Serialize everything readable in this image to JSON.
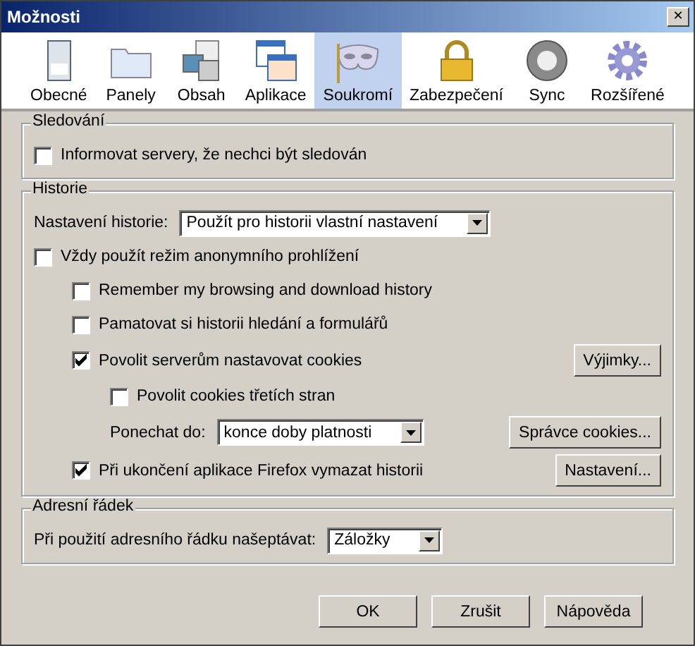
{
  "window": {
    "title": "Možnosti",
    "close": "✕"
  },
  "tabs": [
    {
      "label": "Obecné",
      "selected": false
    },
    {
      "label": "Panely",
      "selected": false
    },
    {
      "label": "Obsah",
      "selected": false
    },
    {
      "label": "Aplikace",
      "selected": false
    },
    {
      "label": "Soukromí",
      "selected": true
    },
    {
      "label": "Zabezpečení",
      "selected": false
    },
    {
      "label": "Sync",
      "selected": false
    },
    {
      "label": "Rozšířené",
      "selected": false
    }
  ],
  "tracking": {
    "title": "Sledování",
    "items": [
      {
        "kind": "checkbox",
        "label": "Informovat servery, že nechci být sledován",
        "checked": false
      }
    ]
  },
  "history": {
    "title": "Historie",
    "items": [
      {
        "kind": "select",
        "label": "Nastavení historie:",
        "value": "Použít pro historii vlastní nastavení"
      },
      {
        "kind": "checkbox",
        "label": "Vždy použít režim anonymního prohlížení",
        "checked": false,
        "children": [
          {
            "kind": "checkbox",
            "label": "Remember my browsing and download history",
            "checked": false
          },
          {
            "kind": "checkbox",
            "label": "Pamatovat si historii hledání a formulářů",
            "checked": false
          },
          {
            "kind": "checkbox",
            "label": "Povolit serverům nastavovat cookies",
            "checked": true,
            "button": "Výjimky...",
            "children": [
              {
                "kind": "checkbox",
                "label": "Povolit cookies třetích stran",
                "checked": false
              },
              {
                "kind": "select",
                "label": "Ponechat do:",
                "value": "konce doby platnosti",
                "button": "Správce cookies..."
              }
            ]
          },
          {
            "kind": "checkbox",
            "label": "Při ukončení aplikace Firefox vymazat historii",
            "checked": true,
            "button": "Nastavení..."
          }
        ]
      }
    ]
  },
  "address_bar": {
    "title": "Adresní řádek",
    "items": [
      {
        "kind": "select",
        "label": "Při použití adresního řádku našeptávat:",
        "value": "Záložky"
      }
    ]
  },
  "buttons": [
    "OK",
    "Zrušit",
    "Nápověda"
  ]
}
